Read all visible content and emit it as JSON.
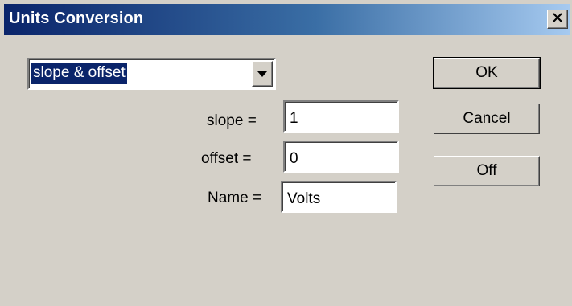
{
  "window": {
    "title": "Units Conversion",
    "close_icon": "close-icon"
  },
  "conversion": {
    "mode_selected": "slope & offset",
    "dropdown_icon": "chevron-down-icon"
  },
  "fields": {
    "slope": {
      "label": "slope =",
      "value": "1"
    },
    "offset": {
      "label": "offset =",
      "value": "0"
    },
    "name": {
      "label": "Name =",
      "value": "Volts"
    }
  },
  "buttons": {
    "ok_label": "OK",
    "cancel_label": "Cancel",
    "off_label": "Off"
  },
  "colors": {
    "dialog_bg": "#d4d0c8",
    "title_start": "#0a246a",
    "title_end": "#a6caf0",
    "selection": "#0a246a"
  }
}
